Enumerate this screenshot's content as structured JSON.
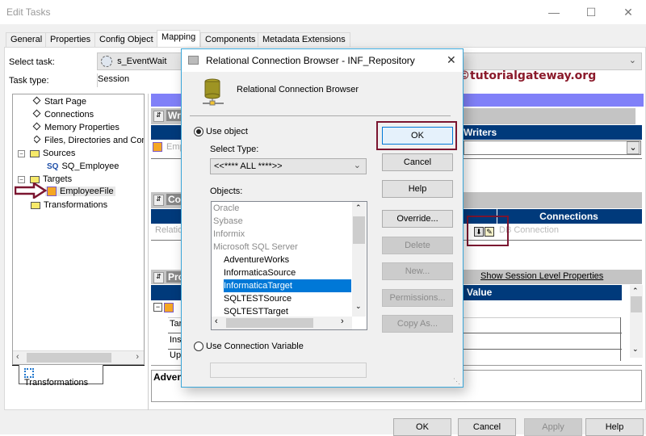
{
  "window": {
    "title": "Edit Tasks",
    "controls": [
      "minimize",
      "maximize",
      "close"
    ]
  },
  "tabs": [
    {
      "label": "General",
      "active": false
    },
    {
      "label": "Properties",
      "active": false
    },
    {
      "label": "Config Object",
      "active": false
    },
    {
      "label": "Mapping",
      "active": true
    },
    {
      "label": "Components",
      "active": false
    },
    {
      "label": "Metadata Extensions",
      "active": false
    }
  ],
  "task": {
    "select_task_label": "Select task:",
    "select_task_value": "s_EventWait",
    "task_type_label": "Task type:",
    "task_type_value": "Session"
  },
  "watermark": "©tutorialgateway.org",
  "tree": {
    "items": [
      {
        "label": "Start Page",
        "icon": "diamond-icon"
      },
      {
        "label": "Connections",
        "icon": "diamond-icon"
      },
      {
        "label": "Memory Properties",
        "icon": "diamond-icon"
      },
      {
        "label": "Files, Directories and Commands",
        "icon": "diamond-icon"
      },
      {
        "label": "Sources",
        "icon": "folder-icon",
        "expanded": true
      },
      {
        "label": "SQ_Employee",
        "icon": "sq-icon"
      },
      {
        "label": "Targets",
        "icon": "folder-icon",
        "expanded": true
      },
      {
        "label": "EmployeeFile",
        "icon": "target-icon",
        "selected": true
      },
      {
        "label": "Transformations",
        "icon": "folder-icon"
      }
    ],
    "bottom_tab": "Transformations"
  },
  "right_panel": {
    "writers_header": "Writers",
    "writers_partial": "Wr",
    "writer_row": "Employee",
    "connections_partial": "Co",
    "connections_header": "Connections",
    "connection_row_left": "Relational",
    "connection_value": "DB Connection",
    "properties_partial": "Pro",
    "show_session_props": "Show Session Level Properties",
    "value_header": "Value",
    "prop_rows": [
      "Tar",
      "Ins",
      "Up"
    ],
    "advanced_partial": "Adven"
  },
  "dialog": {
    "title": "Relational Connection Browser - INF_Repository",
    "heading": "Relational Connection Browser",
    "use_object_label": "Use object",
    "use_object_checked": true,
    "select_type_label": "Select Type:",
    "select_type_value": "<<**** ALL ****>>",
    "objects_label": "Objects:",
    "objects": [
      {
        "label": "Oracle",
        "group": true
      },
      {
        "label": "Sybase",
        "group": true
      },
      {
        "label": "Informix",
        "group": true
      },
      {
        "label": "Microsoft SQL Server",
        "group": true
      },
      {
        "label": "AdventureWorks",
        "group": false
      },
      {
        "label": "InformaticaSource",
        "group": false
      },
      {
        "label": "InformaticaTarget",
        "group": false,
        "selected": true
      },
      {
        "label": "SQLTESTSource",
        "group": false
      },
      {
        "label": "SQLTESTTarget",
        "group": false
      }
    ],
    "use_conn_var_label": "Use Connection Variable",
    "use_conn_var_checked": false,
    "conn_var_value": "",
    "buttons": {
      "ok": "OK",
      "cancel": "Cancel",
      "help": "Help",
      "override": "Override...",
      "delete": "Delete",
      "new": "New...",
      "permissions": "Permissions...",
      "copy_as": "Copy As..."
    }
  },
  "footer": {
    "ok": "OK",
    "cancel": "Cancel",
    "apply": "Apply",
    "help": "Help"
  },
  "colors": {
    "accent_navy": "#003a7b",
    "highlight_red": "#7b1530",
    "selection_blue": "#0078d7",
    "band_purple": "#8080f8"
  }
}
